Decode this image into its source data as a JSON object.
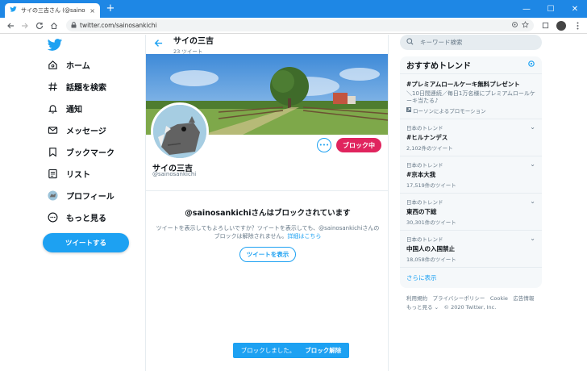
{
  "browser": {
    "tab_title": "サイの三吉さん (@sainosankichi) / Twitter",
    "tab_close": "×",
    "new_tab": "+",
    "url": "twitter.com/sainosankichi",
    "minimize": "—",
    "maximize": "☐",
    "close": "✕"
  },
  "nav": {
    "items": [
      {
        "label": "ホーム",
        "icon": "home-icon"
      },
      {
        "label": "話題を検索",
        "icon": "hashtag-icon"
      },
      {
        "label": "通知",
        "icon": "bell-icon"
      },
      {
        "label": "メッセージ",
        "icon": "envelope-icon"
      },
      {
        "label": "ブックマーク",
        "icon": "bookmark-icon"
      },
      {
        "label": "リスト",
        "icon": "list-icon"
      },
      {
        "label": "プロフィール",
        "icon": "profile-avatar-icon"
      },
      {
        "label": "もっと見る",
        "icon": "more-circle-icon"
      }
    ],
    "tweet_button": "ツイートする"
  },
  "header": {
    "name": "サイの三吉",
    "tweet_count": "23 ツイート"
  },
  "profile": {
    "name": "サイの三吉",
    "handle": "@sainosankichi",
    "more_label": "•••",
    "blocked_label": "ブロック中"
  },
  "blocked": {
    "title": "@sainosankichiさんはブロックされています",
    "desc": "ツイートを表示してもよろしいですか？ツイートを表示しても、@sainosankichiさんのブロックは解除されません。",
    "link": "詳細はこちら",
    "show_button": "ツイートを表示"
  },
  "toast": {
    "message": "ブロックしました。",
    "action": "ブロック解除"
  },
  "search": {
    "placeholder": "キーワード検索"
  },
  "trends": {
    "title": "おすすめトレンド",
    "promoted": {
      "name": "#プレミアムロールケーキ無料プレゼント",
      "desc": "＼10日間連続／毎日1万名様にプレミアムロールケーキ当たる♪",
      "promo": "ローソンによるプロモーション"
    },
    "items": [
      {
        "category": "日本のトレンド",
        "name": "#ヒルナンデス",
        "count": "2,102件のツイート"
      },
      {
        "category": "日本のトレンド",
        "name": "#京本大我",
        "count": "17,519件のツイート"
      },
      {
        "category": "日本のトレンド",
        "name": "東西の下総",
        "count": "30,301件のツイート"
      },
      {
        "category": "日本のトレンド",
        "name": "中国人の入国禁止",
        "count": "18,058件のツイート"
      }
    ],
    "show_more": "さらに表示"
  },
  "footer": {
    "line1": "利用規約　プライバシーポリシー　Cookie　広告情報",
    "line2": "もっと見る ⌄　© 2020 Twitter, Inc."
  },
  "colors": {
    "accent": "#1da1f2",
    "blocked": "#e0245e",
    "titlebar": "#1e87e5"
  }
}
